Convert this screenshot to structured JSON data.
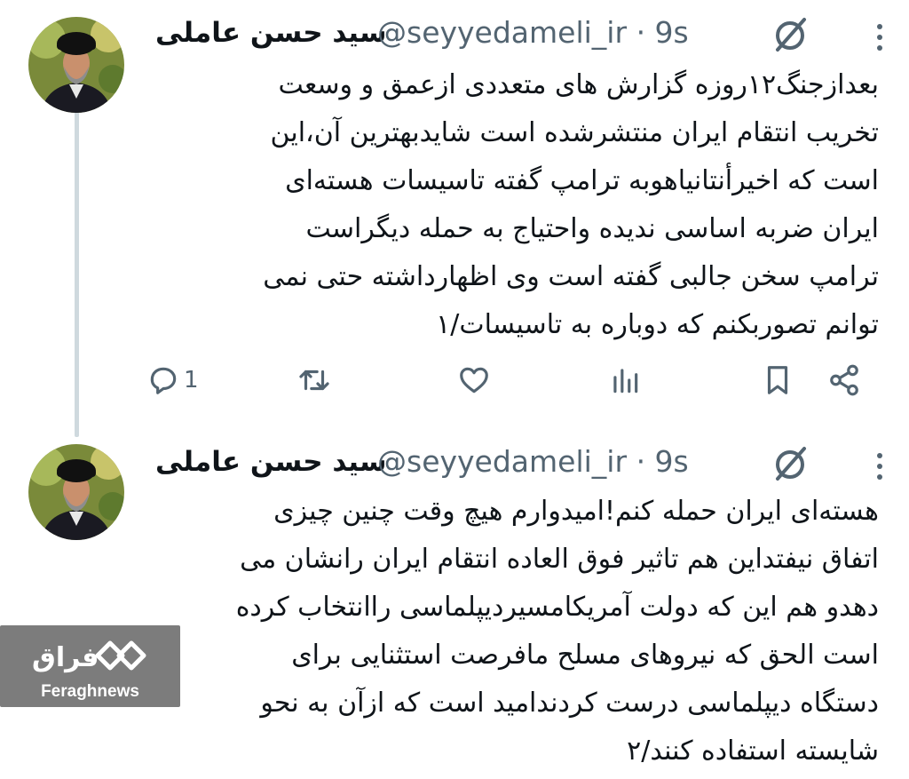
{
  "colors": {
    "secondary_text": "#536471",
    "thread_line": "#cfd9de",
    "watermark_bg": "#5f5f5f"
  },
  "tweets": [
    {
      "author_name": "سید حسن عاملی",
      "handle": "@seyyedameli_ir",
      "time": "· 9s",
      "text": "بعدازجنگ۱۲روزه گزارش های متعددی ازعمق و وسعت\nتخریب انتقام ایران منتشرشده است شایدبهترین آن،این\nاست که اخیرأنتانیاهوبه ترامپ گفته تاسیسات هسته‌ای\nایران ضربه اساسی ندیده واحتیاج به حمله دیگراست\nترامپ سخن جالبی گفته است وی اظهارداشته حتی نمی\nتوانم تصوربکنم که دوباره به تاسیسات/۱",
      "reply_count": "1",
      "icons": [
        "reply-icon",
        "retweet-icon",
        "like-icon",
        "views-icon",
        "bookmark-icon",
        "share-icon"
      ]
    },
    {
      "author_name": "سید حسن عاملی",
      "handle": "@seyyedameli_ir",
      "time": "· 9s",
      "text": "هسته‌ای ایران حمله کنم!امیدوارم هیچ وقت چنین چیزی\nاتفاق نیفتداین هم تاثیر فوق العاده انتقام ایران رانشان می\nدهدو هم این که دولت آمریکامسیردیپلماسی راانتخاب کرده\nاست الحق که نیروهای مسلح مافرصت استثنایی برای\nدستگاه دیپلماسی درست کردندامید است که ازآن به نحو\nشایسته استفاده کنند/۲"
    }
  ],
  "watermark": {
    "brand": "Feraghnews",
    "logo_text": "فراق"
  }
}
